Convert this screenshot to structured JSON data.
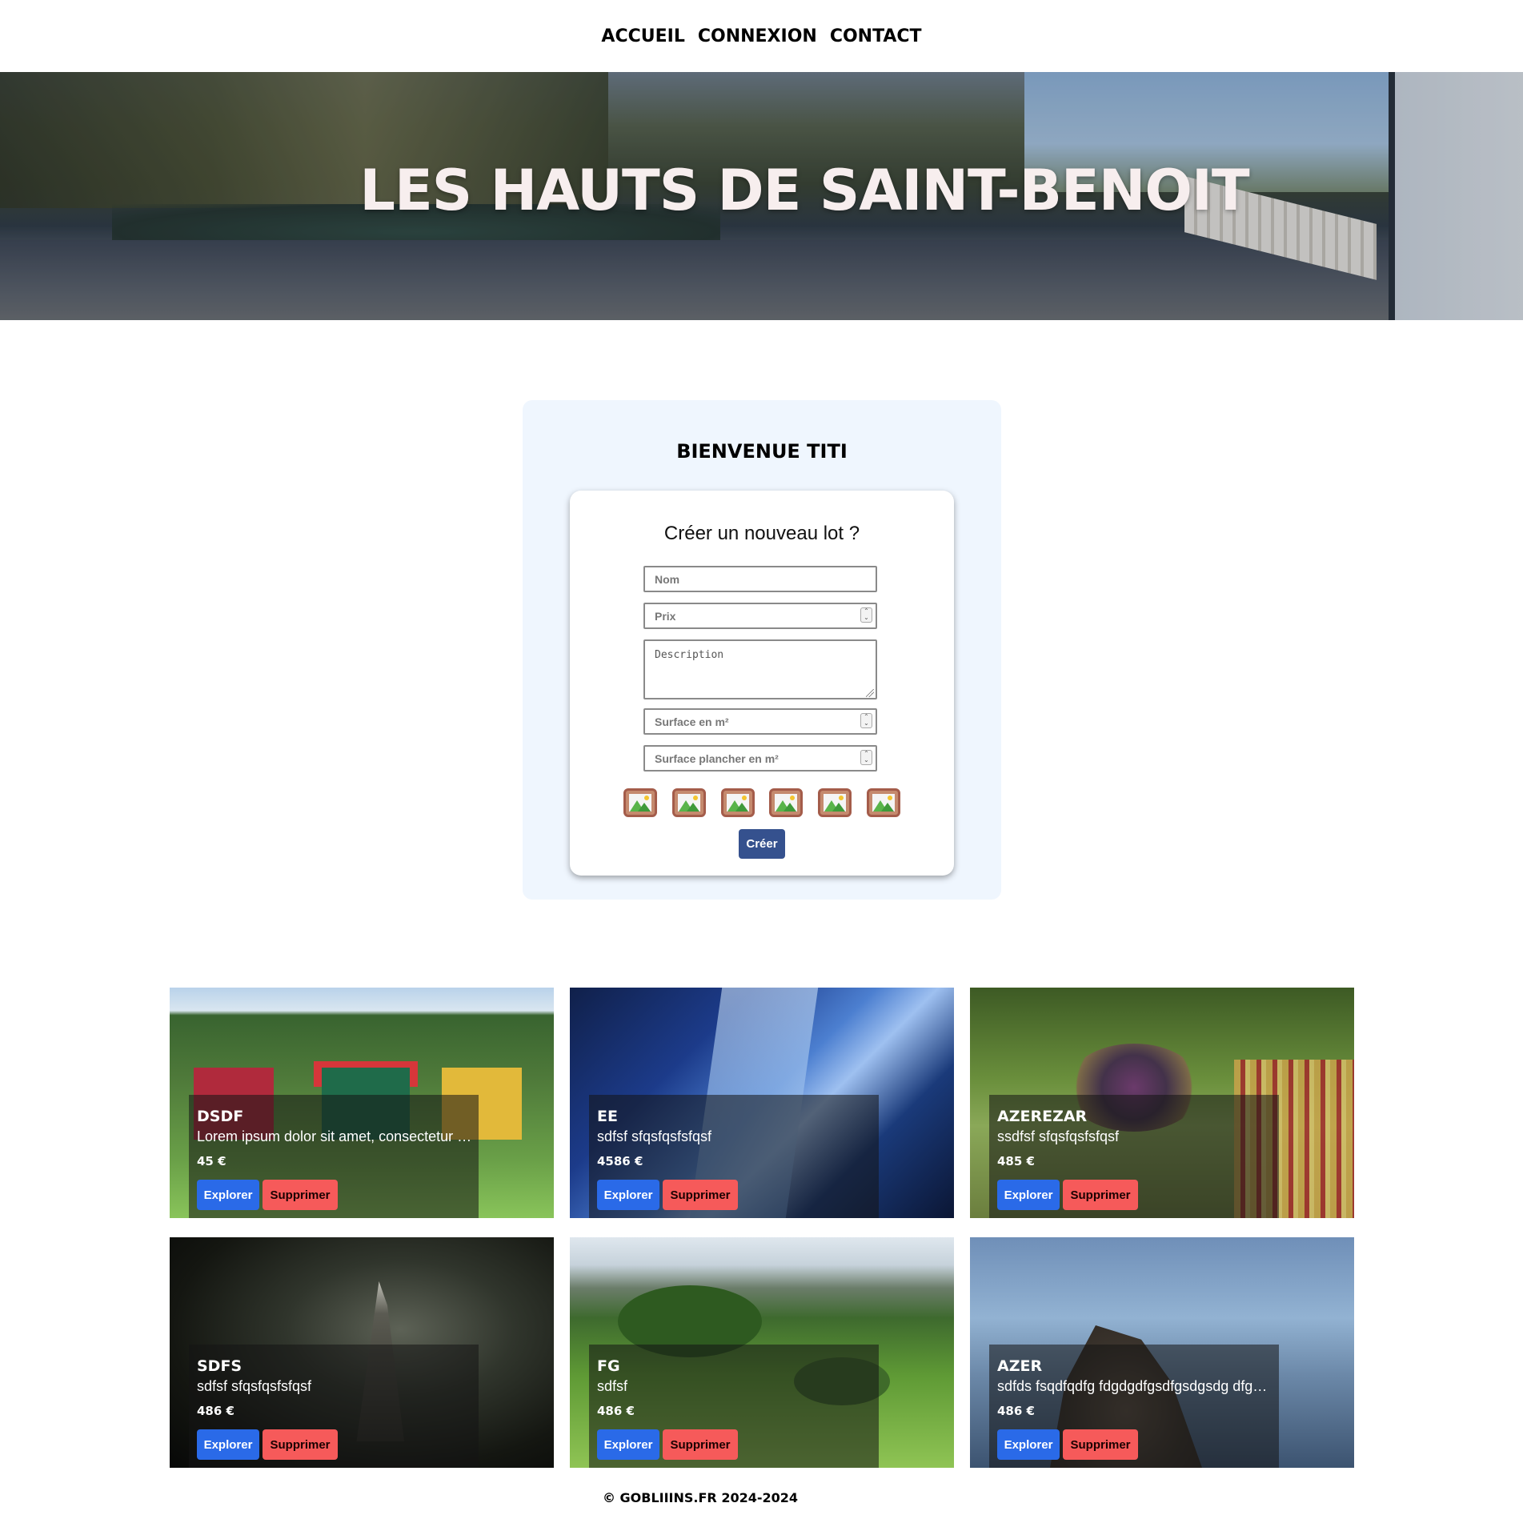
{
  "nav": {
    "items": [
      {
        "label": "ACCUEIL"
      },
      {
        "label": "CONNEXION"
      },
      {
        "label": "CONTACT"
      }
    ]
  },
  "hero": {
    "title": "LES HAUTS DE SAINT-BENOIT"
  },
  "welcome": {
    "title": "BIENVENUE TITI",
    "form": {
      "title": "Créer un nouveau lot ?",
      "name_placeholder": "Nom",
      "price_placeholder": "Prix",
      "description_placeholder": "Description",
      "surface_placeholder": "Surface en m²",
      "floor_surface_placeholder": "Surface plancher en m²",
      "image_icons": [
        "image-upload-icon",
        "image-upload-icon",
        "image-upload-icon",
        "image-upload-icon",
        "image-upload-icon",
        "image-upload-icon"
      ],
      "submit_label": "Créer"
    }
  },
  "lots": [
    {
      "name": "DSDF",
      "description": "Lorem ipsum dolor sit amet, consectetur …",
      "price": "45 €",
      "explore_label": "Explorer",
      "delete_label": "Supprimer"
    },
    {
      "name": "EE",
      "description": "sdfsf sfqsfqsfsfqsf",
      "price": "4586 €",
      "explore_label": "Explorer",
      "delete_label": "Supprimer"
    },
    {
      "name": "AZEREZAR",
      "description": "ssdfsf sfqsfqsfsfqsf",
      "price": "485 €",
      "explore_label": "Explorer",
      "delete_label": "Supprimer"
    },
    {
      "name": "SDFS",
      "description": "sdfsf sfqsfqsfsfqsf",
      "price": "486 €",
      "explore_label": "Explorer",
      "delete_label": "Supprimer"
    },
    {
      "name": "FG",
      "description": "sdfsf",
      "price": "486 €",
      "explore_label": "Explorer",
      "delete_label": "Supprimer"
    },
    {
      "name": "AZER",
      "description": "sdfds fsqdfqdfg fdgdgdfgsdfgsdgsdg dfg…",
      "price": "486 €",
      "explore_label": "Explorer",
      "delete_label": "Supprimer"
    }
  ],
  "footer": {
    "text": "© GOBLIIINS.FR 2024-2024"
  },
  "colors": {
    "explore_button": "#2a6ae8",
    "delete_button": "#f65a5a",
    "create_button": "#35518e",
    "panel_background": "#eff6fe",
    "hero_title": "#f7eeee"
  }
}
